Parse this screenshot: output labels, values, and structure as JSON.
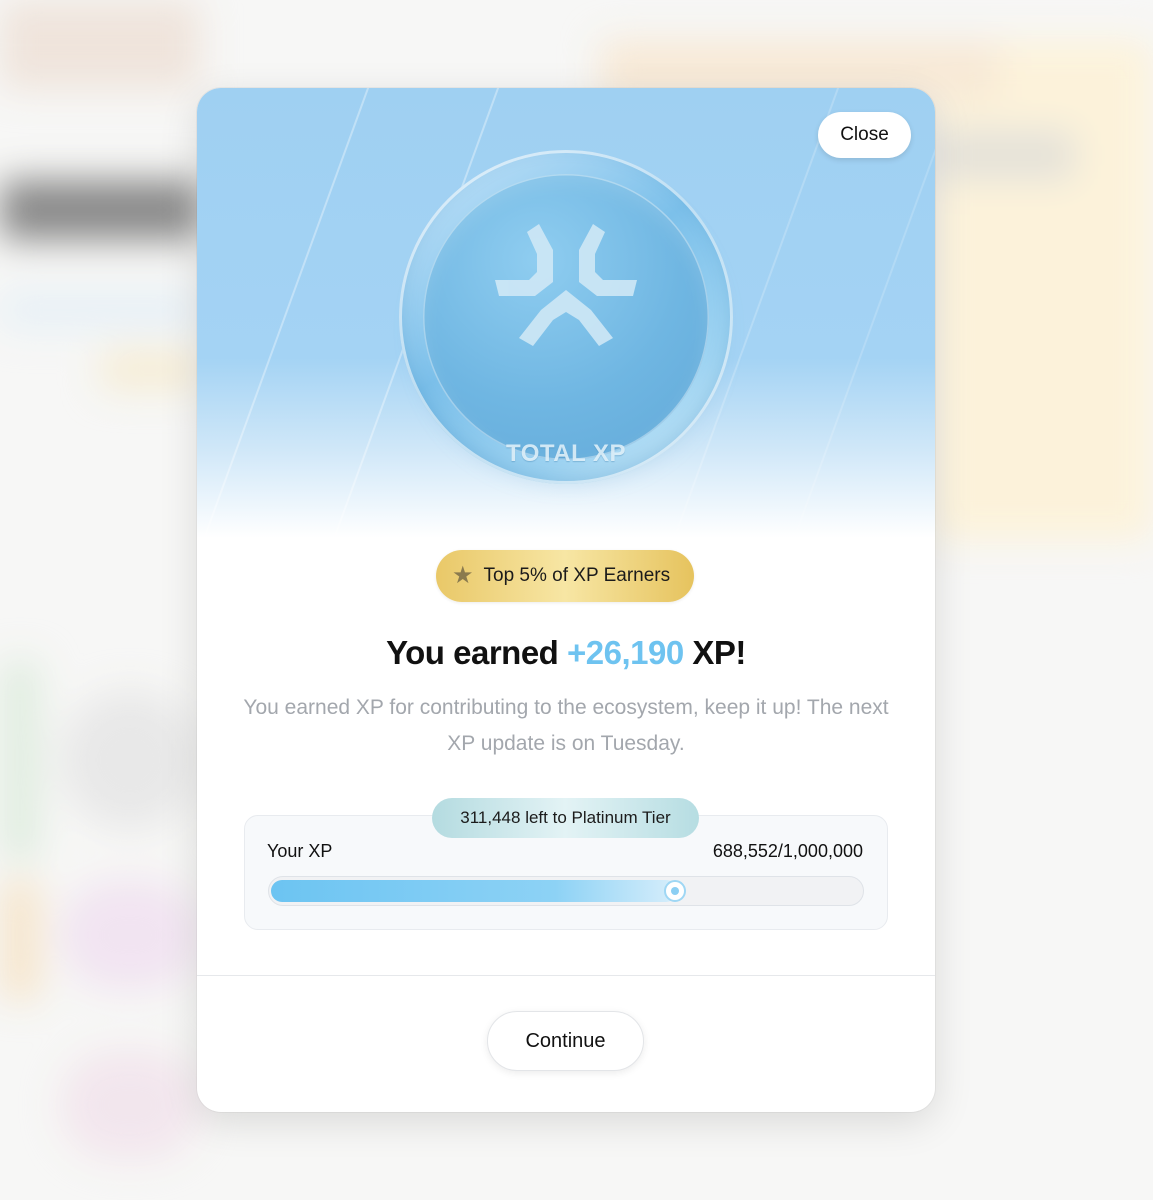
{
  "modal": {
    "close_label": "Close",
    "coin_label": "TOTAL XP",
    "badge_text": "Top 5% of XP Earners",
    "headline": {
      "prefix": "You earned ",
      "amount": "+26,190",
      "suffix": " XP!"
    },
    "description": "You earned XP for contributing to the ecosystem, keep it up! The next XP update is on Tuesday.",
    "progress": {
      "remaining_text": "311,448 left to Platinum Tier",
      "label": "Your XP",
      "value_text": "688,552/1,000,000",
      "fraction": 0.6886
    },
    "continue_label": "Continue"
  },
  "colors": {
    "accent": "#6ec3f0",
    "hero": "#9fd0f2",
    "badge_gold": "#e9c868"
  },
  "icons": {
    "badge": "star-icon",
    "coin_logo": "total-xp-logo-icon"
  }
}
